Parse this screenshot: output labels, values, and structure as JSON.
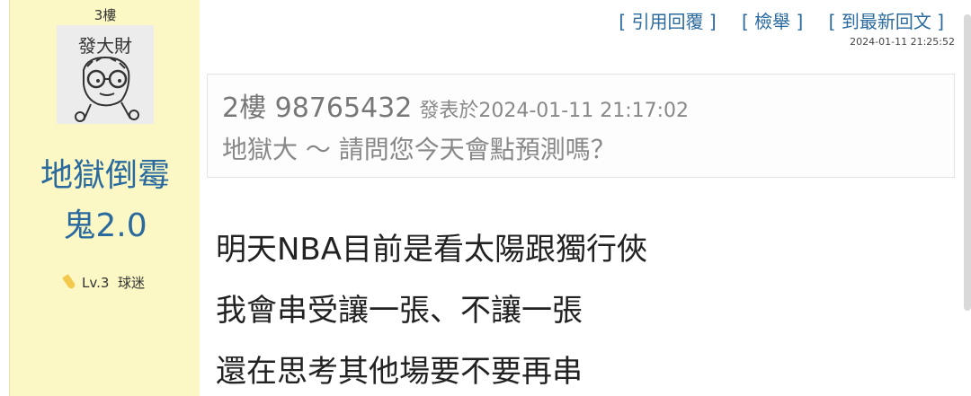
{
  "user": {
    "floor": "3樓",
    "avatar_icon": "doodle-avatar",
    "avatar_caption": "發大財",
    "name_line1": "地獄倒霉",
    "name_line2": "鬼2.0",
    "level": "Lv.3",
    "rank": "球迷"
  },
  "actions": {
    "quote": "[ 引用回覆 ]",
    "report": "[ 檢舉 ]",
    "latest": "[ 到最新回文 ]"
  },
  "post_time": "2024-01-11 21:25:52",
  "quote": {
    "floor": "2樓",
    "user_id": "98765432",
    "posted_label": "發表於",
    "posted_time": "2024-01-11 21:17:02",
    "content": "地獄大 ～ 請問您今天會點預測嗎？"
  },
  "body": {
    "line1": "明天NBA目前是看太陽跟獨行俠",
    "line2": "我會串受讓一張、不讓一張",
    "line3": "還在思考其他場要不要再串"
  },
  "colors": {
    "panel_bg": "#fbf8c5",
    "link": "#2a6a9e"
  }
}
